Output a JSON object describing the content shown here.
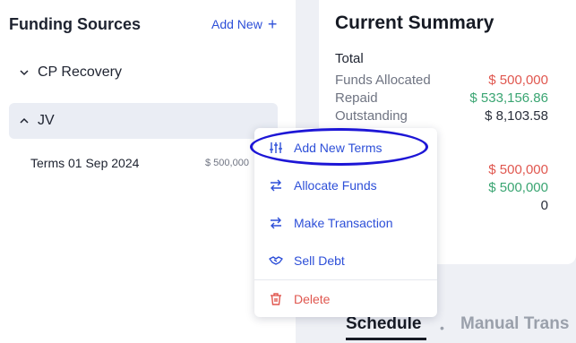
{
  "sidebar": {
    "title": "Funding Sources",
    "add_new_label": "Add New",
    "sources": [
      {
        "name": "CP Recovery"
      },
      {
        "name": "JV"
      }
    ],
    "terms": [
      {
        "label": "Terms 01 Sep 2024",
        "amount": "$ 500,000"
      }
    ]
  },
  "summary": {
    "title": "Current Summary",
    "total_label": "Total",
    "rows": [
      {
        "label": "Funds Allocated",
        "value": "$ 500,000"
      },
      {
        "label": "Repaid",
        "value": "$ 533,156.86"
      },
      {
        "label": "Outstanding",
        "value": "$ 8,103.58"
      }
    ],
    "extra_values": [
      "$ 500,000",
      "$ 500,000",
      "0"
    ]
  },
  "tabs": {
    "schedule": "Schedule",
    "separator": "•",
    "manual": "Manual Trans"
  },
  "context_menu": {
    "items": [
      {
        "label": "Add New Terms",
        "icon": "sliders-icon"
      },
      {
        "label": "Allocate Funds",
        "icon": "swap-arrows-icon"
      },
      {
        "label": "Make Transaction",
        "icon": "swap-arrows-icon"
      },
      {
        "label": "Sell Debt",
        "icon": "handshake-icon"
      },
      {
        "label": "Delete",
        "icon": "trash-icon"
      }
    ]
  },
  "colors": {
    "accent": "#2d4fd8",
    "danger": "#e0574f",
    "positive": "#3aa572",
    "highlight_ring": "#1d16d6"
  }
}
